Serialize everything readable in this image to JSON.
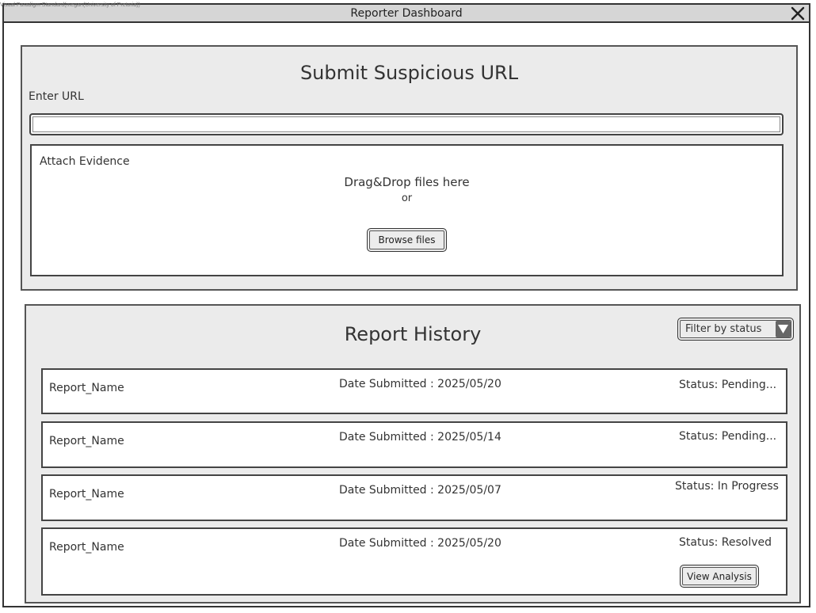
{
  "watermark": "Visual Paradigm Standard(megan(University of Pretoria))",
  "window": {
    "title": "Reporter Dashboard",
    "close_icon": "close-icon"
  },
  "submit": {
    "title": "Submit Suspicious URL",
    "url_label": "Enter URL",
    "url_value": "",
    "evidence_label": "Attach Evidence",
    "drop_text": "Drag&Drop files here",
    "or_text": "or",
    "browse_label": "Browse files"
  },
  "history": {
    "title": "Report History",
    "filter_label": "Filter by status",
    "filter_icon": "triangle-down-icon",
    "reports": [
      {
        "name": "Report_Name",
        "date": "Date Submitted : 2025/05/20",
        "status": "Status: Pending..."
      },
      {
        "name": "Report_Name",
        "date": "Date Submitted : 2025/05/14",
        "status": "Status: Pending..."
      },
      {
        "name": "Report_Name",
        "date": "Date Submitted : 2025/05/07",
        "status": "Status: In Progress"
      },
      {
        "name": "Report_Name",
        "date": "Date Submitted : 2025/05/20",
        "status": "Status: Resolved",
        "action": "View Analysis"
      }
    ]
  },
  "colors": {
    "panel_bg": "#ebebeb",
    "titlebar_bg": "#d6d6d6",
    "border": "#444444"
  }
}
